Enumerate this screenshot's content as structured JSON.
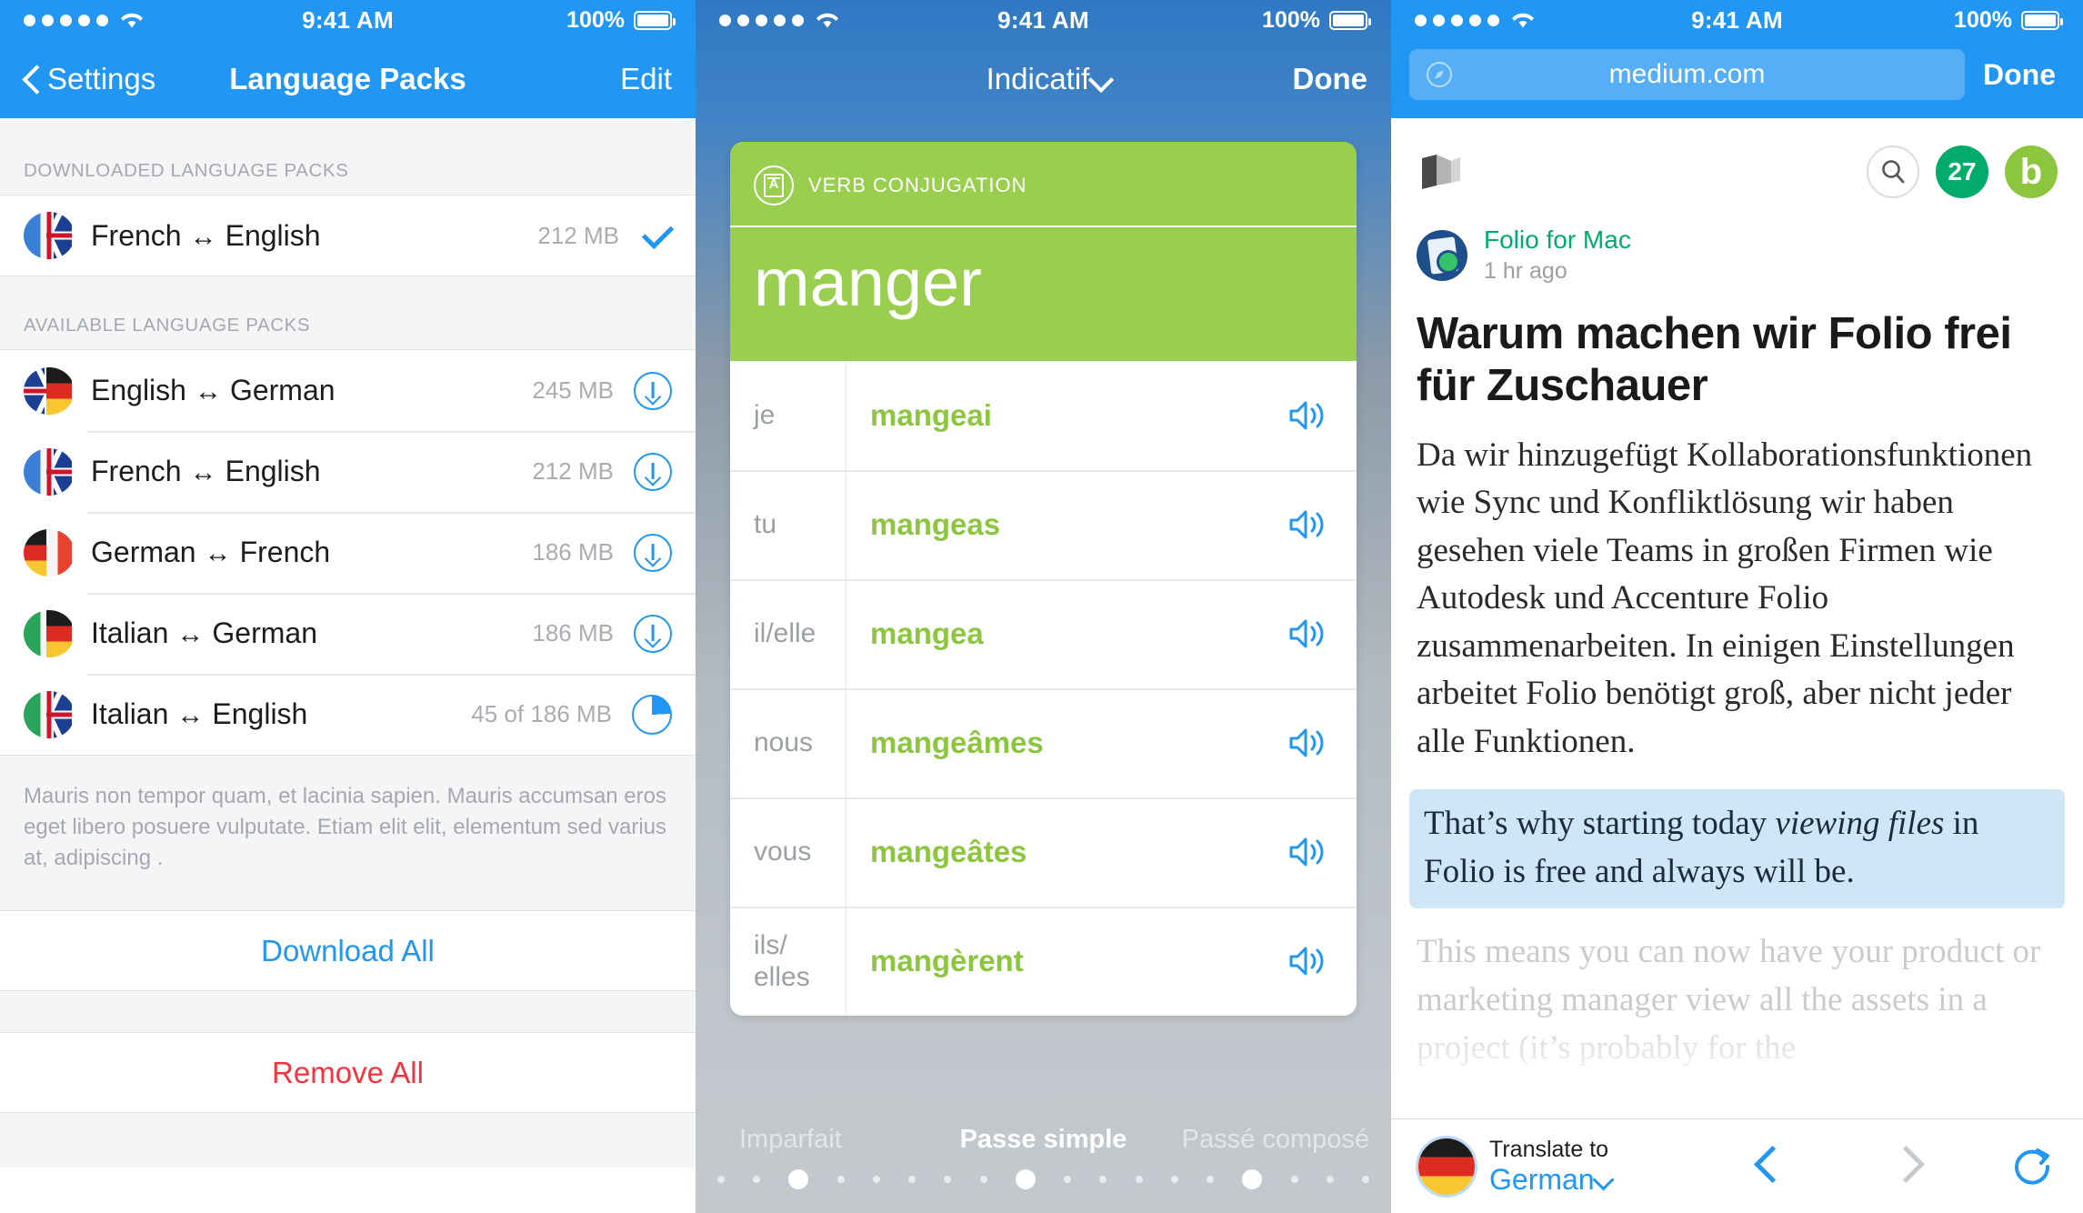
{
  "colors": {
    "ios_blue": "#2196f3",
    "green": "#8cc63f",
    "card_green": "#9ace4e",
    "red": "#f5333f",
    "medium_green": "#00ab6c",
    "highlight_blue": "#cfe6f7"
  },
  "status_bar": {
    "time": "9:41 AM",
    "battery": "100%",
    "signal_dots": 5
  },
  "screen1": {
    "nav": {
      "back_label": "Settings",
      "title": "Language Packs",
      "edit_label": "Edit"
    },
    "sections": [
      {
        "header": "DOWNLOADED LANGUAGE PACKS",
        "rows": [
          {
            "from": "French",
            "to": "English",
            "flag_from": "fr",
            "flag_to": "uk",
            "size": "212 MB",
            "accessory": "check"
          }
        ]
      },
      {
        "header": "AVAILABLE LANGUAGE PACKS",
        "rows": [
          {
            "from": "English",
            "to": "German",
            "flag_from": "uk",
            "flag_to": "de",
            "size": "245 MB",
            "accessory": "download"
          },
          {
            "from": "French",
            "to": "English",
            "flag_from": "fr",
            "flag_to": "uk",
            "size": "212 MB",
            "accessory": "download"
          },
          {
            "from": "German",
            "to": "French",
            "flag_from": "de",
            "flag_to": "fr",
            "size": "186 MB",
            "accessory": "download"
          },
          {
            "from": "Italian",
            "to": "German",
            "flag_from": "it",
            "flag_to": "de",
            "size": "186 MB",
            "accessory": "download"
          },
          {
            "from": "Italian",
            "to": "English",
            "flag_from": "it",
            "flag_to": "uk",
            "size": "45 of 186 MB",
            "accessory": "progress"
          }
        ]
      }
    ],
    "arrow_glyph": "↔",
    "footer_note": "Mauris non tempor quam, et lacinia sapien. Mauris accumsan eros eget libero posuere vulputate. Etiam elit elit, elementum sed varius at, adipiscing .",
    "download_all_label": "Download All",
    "remove_all_label": "Remove All"
  },
  "screen2": {
    "nav": {
      "title": "Indicatif",
      "done_label": "Done"
    },
    "card": {
      "kicker": "VERB CONJUGATION",
      "verb": "manger",
      "rows": [
        {
          "pronoun": "je",
          "form": "mangeai"
        },
        {
          "pronoun": "tu",
          "form": "mangeas"
        },
        {
          "pronoun": "il/elle",
          "form": "mangea"
        },
        {
          "pronoun": "nous",
          "form": "mangeâmes"
        },
        {
          "pronoun": "vous",
          "form": "mangeâtes"
        },
        {
          "pronoun": "ils/\nelles",
          "form": "mangèrent"
        }
      ]
    },
    "tenses": {
      "previous": "Imparfait",
      "current": "Passe simple",
      "next": "Passé composé"
    },
    "page_dots": {
      "count": 18,
      "big_indices": [
        2,
        8,
        14
      ]
    }
  },
  "screen3": {
    "browser": {
      "url": "medium.com",
      "done_label": "Done"
    },
    "header": {
      "search_icon": "search-icon",
      "notification_count": "27",
      "avatar_letter": "b"
    },
    "byline": {
      "publication": "Folio for Mac",
      "time_ago": "1 hr ago"
    },
    "headline": "Warum machen wir Folio frei für Zuschauer",
    "paragraph": "Da wir hinzugefügt Kollaborationsfunktionen wie Sync und Konfliktlösung wir haben gesehen viele Teams in großen Firmen wie Autodesk und Accenture Folio zusammenarbeiten. In einigen Einstellungen arbeitet Folio benötigt groß, aber nicht jeder alle Funktionen.",
    "quote_pre": "That’s why starting today ",
    "quote_em": "viewing files",
    "quote_post": " in Folio is free and always will be.",
    "paragraph_faded": "This means you can now have your product or marketing manager view all the assets in a project (it’s probably for the",
    "toolbar": {
      "translate_label": "Translate to",
      "translate_language": "German",
      "back_icon": "chevron-left-icon",
      "forward_icon": "chevron-right-icon",
      "reload_icon": "reload-icon"
    }
  }
}
